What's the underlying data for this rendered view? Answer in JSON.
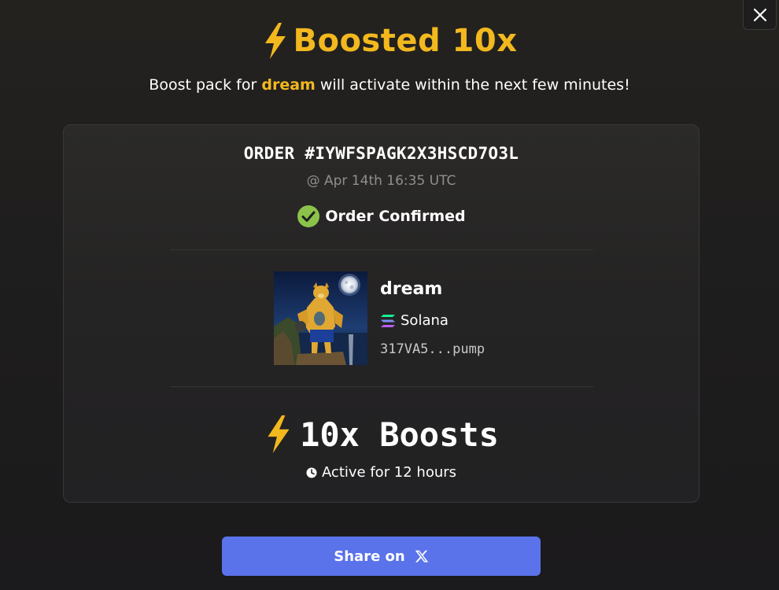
{
  "dialog": {
    "title": "Boosted 10x",
    "subtitle_prefix": "Boost pack for",
    "subtitle_token": "dream",
    "subtitle_suffix": "will activate within the next few minutes!",
    "close_icon": "close-icon"
  },
  "order": {
    "id": "ORDER #IYWFSPAGK2X3HSCD7O3L",
    "timestamp": "@ Apr 14th 16:35 UTC",
    "status": "Order Confirmed",
    "status_color": "#8bc34a"
  },
  "token": {
    "name": "dream",
    "chain": "Solana",
    "address": "317VA5...pump",
    "image_icon": "token-avatar"
  },
  "boost": {
    "label": "10x Boosts",
    "duration": "Active for 12 hours",
    "icon": "lightning-icon"
  },
  "share": {
    "label": "Share on",
    "icon": "x-logo-icon",
    "color": "#5a72ea"
  },
  "colors": {
    "accent": "#f2b81e",
    "background": "#1f1e1e"
  }
}
